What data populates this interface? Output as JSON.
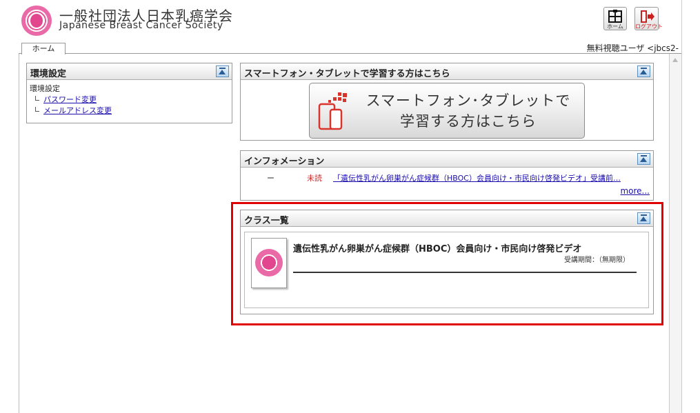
{
  "header": {
    "org_name_ja": "一般社団法人日本乳癌学会",
    "org_name_en": "Japanese Breast Cancer Society",
    "home_label": "ホーム",
    "logout_label": "ログアウト"
  },
  "tabs": {
    "home": "ホーム",
    "user_info": "無料視聴ユーザ <jbcs2-"
  },
  "settings_panel": {
    "title": "環境設定",
    "heading": "環境設定",
    "links": [
      {
        "label": "パスワード変更"
      },
      {
        "label": "メールアドレス変更"
      }
    ]
  },
  "smartphone_panel": {
    "title": "スマートフォン・タブレットで学習する方はこちら",
    "button_line1": "スマートフォン･タブレットで",
    "button_line2": "学習する方はこちら"
  },
  "info_panel": {
    "title": "インフォメーション",
    "row": {
      "date": "ー",
      "status": "未読",
      "text": "「遺伝性乳がん卵巣がん症候群（HBOC）会員向け・市民向け啓発ビデオ」受講前…"
    },
    "more": "more..."
  },
  "class_panel": {
    "title": "クラス一覧",
    "item": {
      "title": "遺伝性乳がん卵巣がん症候群（HBOC）会員向け・市民向け啓発ビデオ",
      "period": "受講期間：（無期限）"
    }
  },
  "colors": {
    "brand_pink": "#e2468f",
    "highlight_red": "#e00000",
    "link_blue": "#1a0dab",
    "unread_red": "#cc2a2a",
    "smart_icon_red": "#d9342b"
  },
  "icons": [
    "logo-seal-icon",
    "home-icon",
    "logout-icon",
    "collapse-icon",
    "smartphone-tablet-icon"
  ]
}
